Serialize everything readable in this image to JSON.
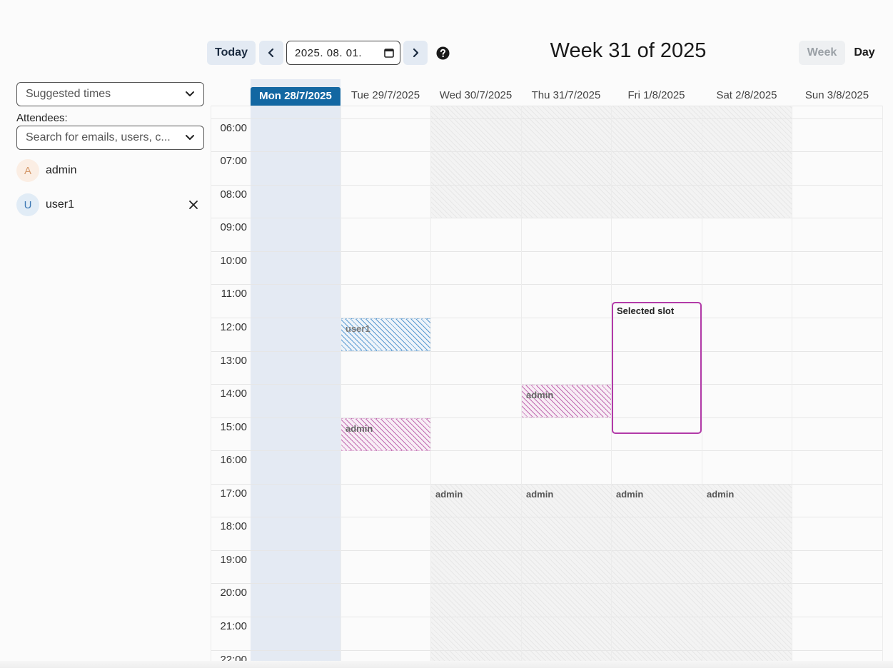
{
  "header": {
    "today_label": "Today",
    "date_value": "2025. 08. 01.",
    "week_title": "Week 31 of 2025",
    "view_week_label": "Week",
    "view_day_label": "Day"
  },
  "sidebar": {
    "suggested_times_label": "Suggested times",
    "attendees_label": "Attendees:",
    "search_placeholder": "Search for emails, users, c...",
    "attendees": [
      {
        "initial": "A",
        "name": "admin",
        "removable": false
      },
      {
        "initial": "U",
        "name": "user1",
        "removable": true
      }
    ]
  },
  "calendar": {
    "days": [
      "Mon 28/7/2025",
      "Tue 29/7/2025",
      "Wed 30/7/2025",
      "Thu 31/7/2025",
      "Fri 1/8/2025",
      "Sat 2/8/2025",
      "Sun 3/8/2025"
    ],
    "highlighted_day_index": 0,
    "hours": [
      "06:00",
      "07:00",
      "08:00",
      "09:00",
      "10:00",
      "11:00",
      "12:00",
      "13:00",
      "14:00",
      "15:00",
      "16:00",
      "17:00",
      "18:00",
      "19:00",
      "20:00",
      "21:00",
      "22:00"
    ],
    "events": [
      {
        "label": "user1",
        "day": "Tue 29/7/2025",
        "start": "12:00",
        "end": "13:00",
        "style": "blue"
      },
      {
        "label": "admin",
        "day": "Tue 29/7/2025",
        "start": "15:00",
        "end": "16:00",
        "style": "pink"
      },
      {
        "label": "admin",
        "day": "Thu 31/7/2025",
        "start": "14:00",
        "end": "15:00",
        "style": "pink"
      },
      {
        "label": "admin",
        "day": "Wed 30/7/2025",
        "start": "17:00",
        "end": "",
        "style": "grey"
      },
      {
        "label": "admin",
        "day": "Thu 31/7/2025",
        "start": "17:00",
        "end": "",
        "style": "grey"
      },
      {
        "label": "admin",
        "day": "Fri 1/8/2025",
        "start": "17:00",
        "end": "",
        "style": "grey"
      },
      {
        "label": "admin",
        "day": "Sat 2/8/2025",
        "start": "17:00",
        "end": "",
        "style": "grey"
      }
    ],
    "selected_slot": {
      "label": "Selected slot",
      "day": "Fri 1/8/2025",
      "start": "11:30",
      "end": "15:30"
    }
  },
  "colors": {
    "today_header": "#1267a2",
    "highlight_column": "#e4eaf3",
    "selected_slot_border": "#b23aa8",
    "user1_event": "#5b9ad1",
    "admin_event": "#c06bb0"
  }
}
